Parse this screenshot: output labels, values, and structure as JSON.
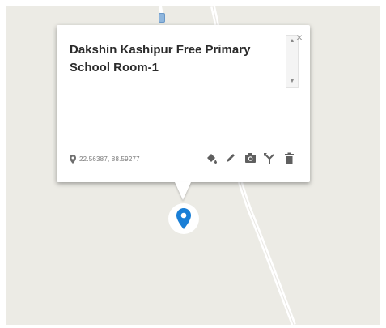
{
  "popup": {
    "title": "Dakshin Kashipur Free Primary School Room-1",
    "coordinates": "22.56387, 88.59277",
    "close_icon": "close-icon",
    "tools": [
      "paint-bucket-icon",
      "pencil-icon",
      "camera-icon",
      "directions-icon",
      "trash-icon"
    ]
  },
  "map": {
    "pin_color": "#1a7fd6",
    "background_color": "#ecebe5",
    "road_color": "#ffffff"
  }
}
